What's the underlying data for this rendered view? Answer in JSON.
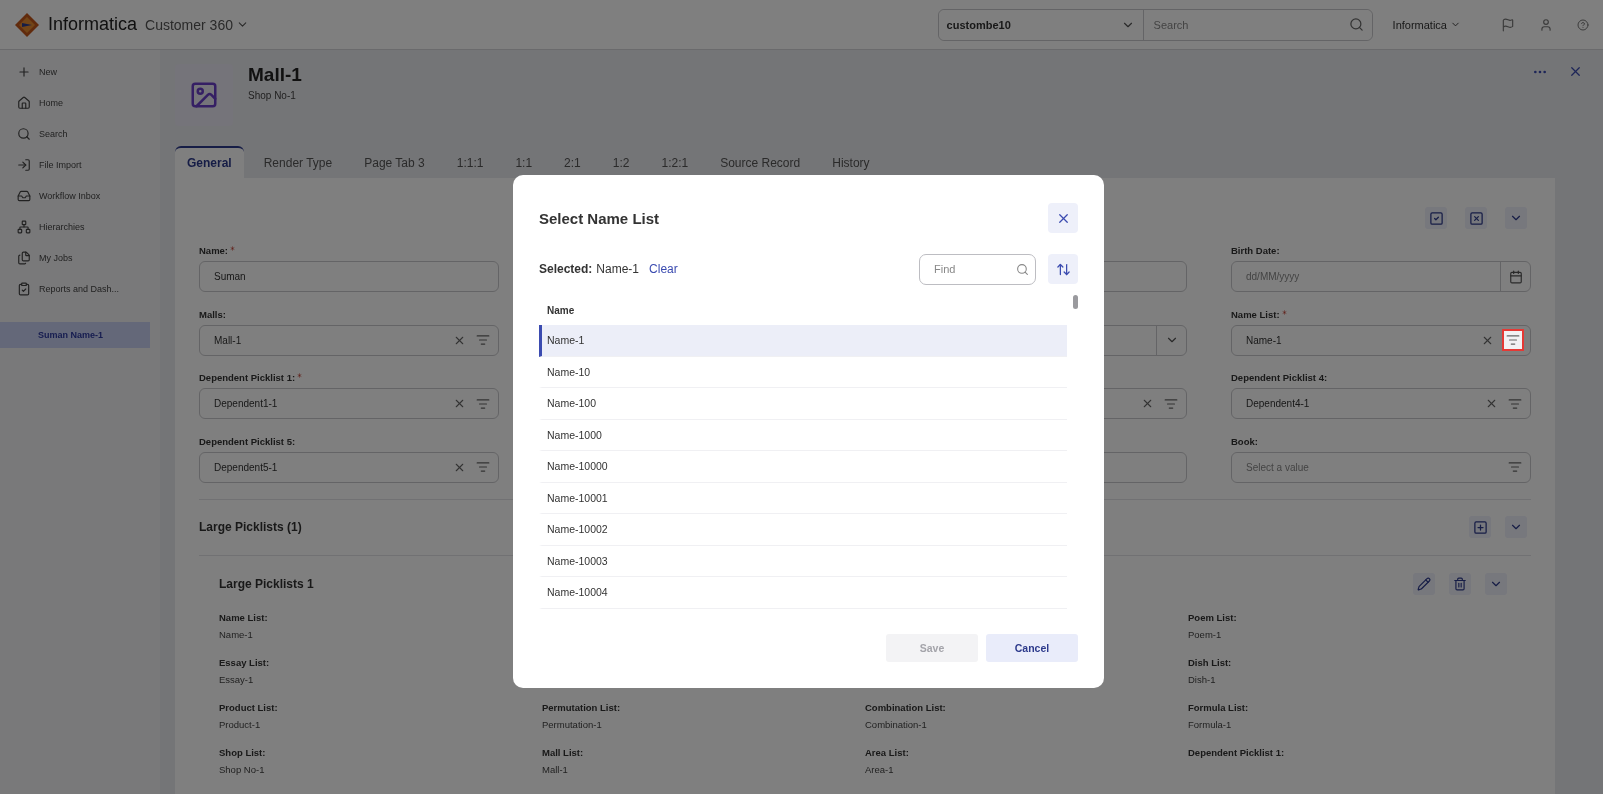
{
  "app": {
    "brand": "Informatica",
    "product": "Customer 360",
    "tenant": "custombe10",
    "search_placeholder": "Search",
    "org": "Informatica"
  },
  "sidebar": {
    "items": [
      {
        "label": "New"
      },
      {
        "label": "Home"
      },
      {
        "label": "Search"
      },
      {
        "label": "File Import"
      },
      {
        "label": "Workflow Inbox"
      },
      {
        "label": "Hierarchies"
      },
      {
        "label": "My Jobs"
      },
      {
        "label": "Reports and Dash..."
      }
    ],
    "recent": [
      {
        "label": "Suman Name-1",
        "selected": true
      }
    ]
  },
  "record": {
    "title": "Mall-1",
    "subtitle": "Shop No-1"
  },
  "tabs": [
    {
      "label": "General",
      "selected": true
    },
    {
      "label": "Render Type",
      "selected": false
    },
    {
      "label": "Page Tab 3",
      "selected": false
    },
    {
      "label": "1:1:1",
      "selected": false
    },
    {
      "label": "1:1",
      "selected": false
    },
    {
      "label": "2:1",
      "selected": false
    },
    {
      "label": "1:2",
      "selected": false
    },
    {
      "label": "1:2:1",
      "selected": false
    },
    {
      "label": "Source Record",
      "selected": false
    },
    {
      "label": "History",
      "selected": false
    }
  ],
  "form": {
    "rows": [
      {
        "column_1": {
          "kind": "text",
          "label": "Name:",
          "required": true,
          "value": "Suman"
        },
        "column_3": {
          "kind": "text"
        },
        "column_4": {
          "kind": "date",
          "label": "Birth Date:",
          "placeholder": "dd/MM/yyyy"
        }
      },
      {
        "column_1": {
          "kind": "lookup",
          "label": "Malls:",
          "value": "Mall-1"
        },
        "column_3": {
          "kind": "dropdown"
        },
        "column_4": {
          "kind": "lookup",
          "label": "Name List:",
          "required": true,
          "value": "Name-1",
          "highlighted": true
        }
      },
      {
        "column_1": {
          "kind": "lookup",
          "label": "Dependent Picklist 1:",
          "required": true,
          "value": "Dependent1-1"
        },
        "column_3": {
          "kind": "lookup"
        },
        "column_4": {
          "kind": "lookup",
          "label": "Dependent Picklist 4:",
          "value": "Dependent4-1"
        }
      },
      {
        "column_1": {
          "kind": "lookup",
          "label": "Dependent Picklist 5:",
          "value": "Dependent5-1"
        },
        "column_3": {
          "kind": "text"
        },
        "column_4": {
          "kind": "picklist",
          "label": "Book:",
          "placeholder": "Select a value"
        }
      }
    ]
  },
  "section": {
    "title": "Large Picklists (1)",
    "item_title": "Large Picklists 1",
    "details": [
      {
        "column_1": {
          "label": "Name List:",
          "value": "Name-1"
        },
        "column_4": {
          "label": "Poem List:",
          "value": "Poem-1"
        }
      },
      {
        "column_1": {
          "label": "Essay List:",
          "value": "Essay-1"
        },
        "column_4": {
          "label": "Dish List:",
          "value": "Dish-1"
        }
      },
      {
        "column_1": {
          "label": "Product List:",
          "value": "Product-1"
        },
        "column_2": {
          "label": "Permutation List:",
          "value": "Permutation-1"
        },
        "column_3": {
          "label": "Combination List:",
          "value": "Combination-1"
        },
        "column_4": {
          "label": "Formula List:",
          "value": "Formula-1"
        }
      },
      {
        "column_1": {
          "label": "Shop List:",
          "value": "Shop No-1"
        },
        "column_2": {
          "label": "Mall List:",
          "value": "Mall-1"
        },
        "column_3": {
          "label": "Area List:",
          "value": "Area-1"
        },
        "column_4": {
          "label": "Dependent Picklist 1:"
        }
      }
    ]
  },
  "dialog": {
    "title": "Select Name List",
    "selected_label": "Selected:",
    "selected_value": "Name-1",
    "clear": "Clear",
    "find_placeholder": "Find",
    "column": "Name",
    "rows": [
      {
        "label": "Name-1",
        "selected": true
      },
      {
        "label": "Name-10",
        "selected": false
      },
      {
        "label": "Name-100",
        "selected": false
      },
      {
        "label": "Name-1000",
        "selected": false
      },
      {
        "label": "Name-10000",
        "selected": false
      },
      {
        "label": "Name-10001",
        "selected": false
      },
      {
        "label": "Name-10002",
        "selected": false
      },
      {
        "label": "Name-10003",
        "selected": false
      },
      {
        "label": "Name-10004",
        "selected": false
      }
    ],
    "buttons": [
      {
        "label": "Save",
        "disabled": true
      },
      {
        "label": "Cancel",
        "disabled": false
      }
    ]
  }
}
